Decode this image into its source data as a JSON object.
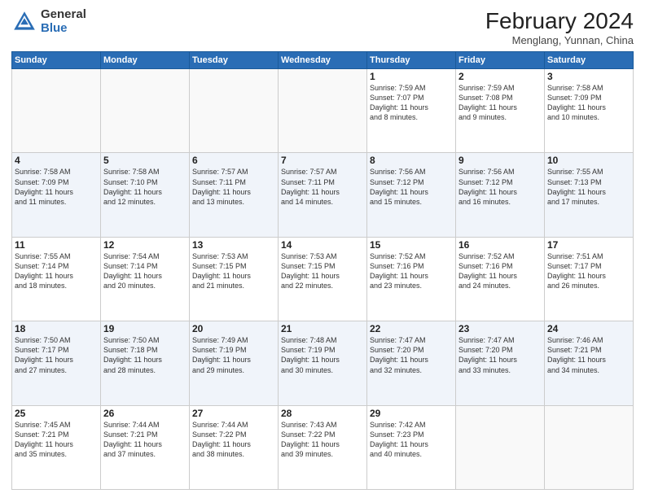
{
  "logo": {
    "general": "General",
    "blue": "Blue"
  },
  "title": {
    "month": "February 2024",
    "location": "Menglang, Yunnan, China"
  },
  "headers": [
    "Sunday",
    "Monday",
    "Tuesday",
    "Wednesday",
    "Thursday",
    "Friday",
    "Saturday"
  ],
  "weeks": [
    [
      {
        "day": "",
        "info": ""
      },
      {
        "day": "",
        "info": ""
      },
      {
        "day": "",
        "info": ""
      },
      {
        "day": "",
        "info": ""
      },
      {
        "day": "1",
        "info": "Sunrise: 7:59 AM\nSunset: 7:07 PM\nDaylight: 11 hours\nand 8 minutes."
      },
      {
        "day": "2",
        "info": "Sunrise: 7:59 AM\nSunset: 7:08 PM\nDaylight: 11 hours\nand 9 minutes."
      },
      {
        "day": "3",
        "info": "Sunrise: 7:58 AM\nSunset: 7:09 PM\nDaylight: 11 hours\nand 10 minutes."
      }
    ],
    [
      {
        "day": "4",
        "info": "Sunrise: 7:58 AM\nSunset: 7:09 PM\nDaylight: 11 hours\nand 11 minutes."
      },
      {
        "day": "5",
        "info": "Sunrise: 7:58 AM\nSunset: 7:10 PM\nDaylight: 11 hours\nand 12 minutes."
      },
      {
        "day": "6",
        "info": "Sunrise: 7:57 AM\nSunset: 7:11 PM\nDaylight: 11 hours\nand 13 minutes."
      },
      {
        "day": "7",
        "info": "Sunrise: 7:57 AM\nSunset: 7:11 PM\nDaylight: 11 hours\nand 14 minutes."
      },
      {
        "day": "8",
        "info": "Sunrise: 7:56 AM\nSunset: 7:12 PM\nDaylight: 11 hours\nand 15 minutes."
      },
      {
        "day": "9",
        "info": "Sunrise: 7:56 AM\nSunset: 7:12 PM\nDaylight: 11 hours\nand 16 minutes."
      },
      {
        "day": "10",
        "info": "Sunrise: 7:55 AM\nSunset: 7:13 PM\nDaylight: 11 hours\nand 17 minutes."
      }
    ],
    [
      {
        "day": "11",
        "info": "Sunrise: 7:55 AM\nSunset: 7:14 PM\nDaylight: 11 hours\nand 18 minutes."
      },
      {
        "day": "12",
        "info": "Sunrise: 7:54 AM\nSunset: 7:14 PM\nDaylight: 11 hours\nand 20 minutes."
      },
      {
        "day": "13",
        "info": "Sunrise: 7:53 AM\nSunset: 7:15 PM\nDaylight: 11 hours\nand 21 minutes."
      },
      {
        "day": "14",
        "info": "Sunrise: 7:53 AM\nSunset: 7:15 PM\nDaylight: 11 hours\nand 22 minutes."
      },
      {
        "day": "15",
        "info": "Sunrise: 7:52 AM\nSunset: 7:16 PM\nDaylight: 11 hours\nand 23 minutes."
      },
      {
        "day": "16",
        "info": "Sunrise: 7:52 AM\nSunset: 7:16 PM\nDaylight: 11 hours\nand 24 minutes."
      },
      {
        "day": "17",
        "info": "Sunrise: 7:51 AM\nSunset: 7:17 PM\nDaylight: 11 hours\nand 26 minutes."
      }
    ],
    [
      {
        "day": "18",
        "info": "Sunrise: 7:50 AM\nSunset: 7:17 PM\nDaylight: 11 hours\nand 27 minutes."
      },
      {
        "day": "19",
        "info": "Sunrise: 7:50 AM\nSunset: 7:18 PM\nDaylight: 11 hours\nand 28 minutes."
      },
      {
        "day": "20",
        "info": "Sunrise: 7:49 AM\nSunset: 7:19 PM\nDaylight: 11 hours\nand 29 minutes."
      },
      {
        "day": "21",
        "info": "Sunrise: 7:48 AM\nSunset: 7:19 PM\nDaylight: 11 hours\nand 30 minutes."
      },
      {
        "day": "22",
        "info": "Sunrise: 7:47 AM\nSunset: 7:20 PM\nDaylight: 11 hours\nand 32 minutes."
      },
      {
        "day": "23",
        "info": "Sunrise: 7:47 AM\nSunset: 7:20 PM\nDaylight: 11 hours\nand 33 minutes."
      },
      {
        "day": "24",
        "info": "Sunrise: 7:46 AM\nSunset: 7:21 PM\nDaylight: 11 hours\nand 34 minutes."
      }
    ],
    [
      {
        "day": "25",
        "info": "Sunrise: 7:45 AM\nSunset: 7:21 PM\nDaylight: 11 hours\nand 35 minutes."
      },
      {
        "day": "26",
        "info": "Sunrise: 7:44 AM\nSunset: 7:21 PM\nDaylight: 11 hours\nand 37 minutes."
      },
      {
        "day": "27",
        "info": "Sunrise: 7:44 AM\nSunset: 7:22 PM\nDaylight: 11 hours\nand 38 minutes."
      },
      {
        "day": "28",
        "info": "Sunrise: 7:43 AM\nSunset: 7:22 PM\nDaylight: 11 hours\nand 39 minutes."
      },
      {
        "day": "29",
        "info": "Sunrise: 7:42 AM\nSunset: 7:23 PM\nDaylight: 11 hours\nand 40 minutes."
      },
      {
        "day": "",
        "info": ""
      },
      {
        "day": "",
        "info": ""
      }
    ]
  ]
}
